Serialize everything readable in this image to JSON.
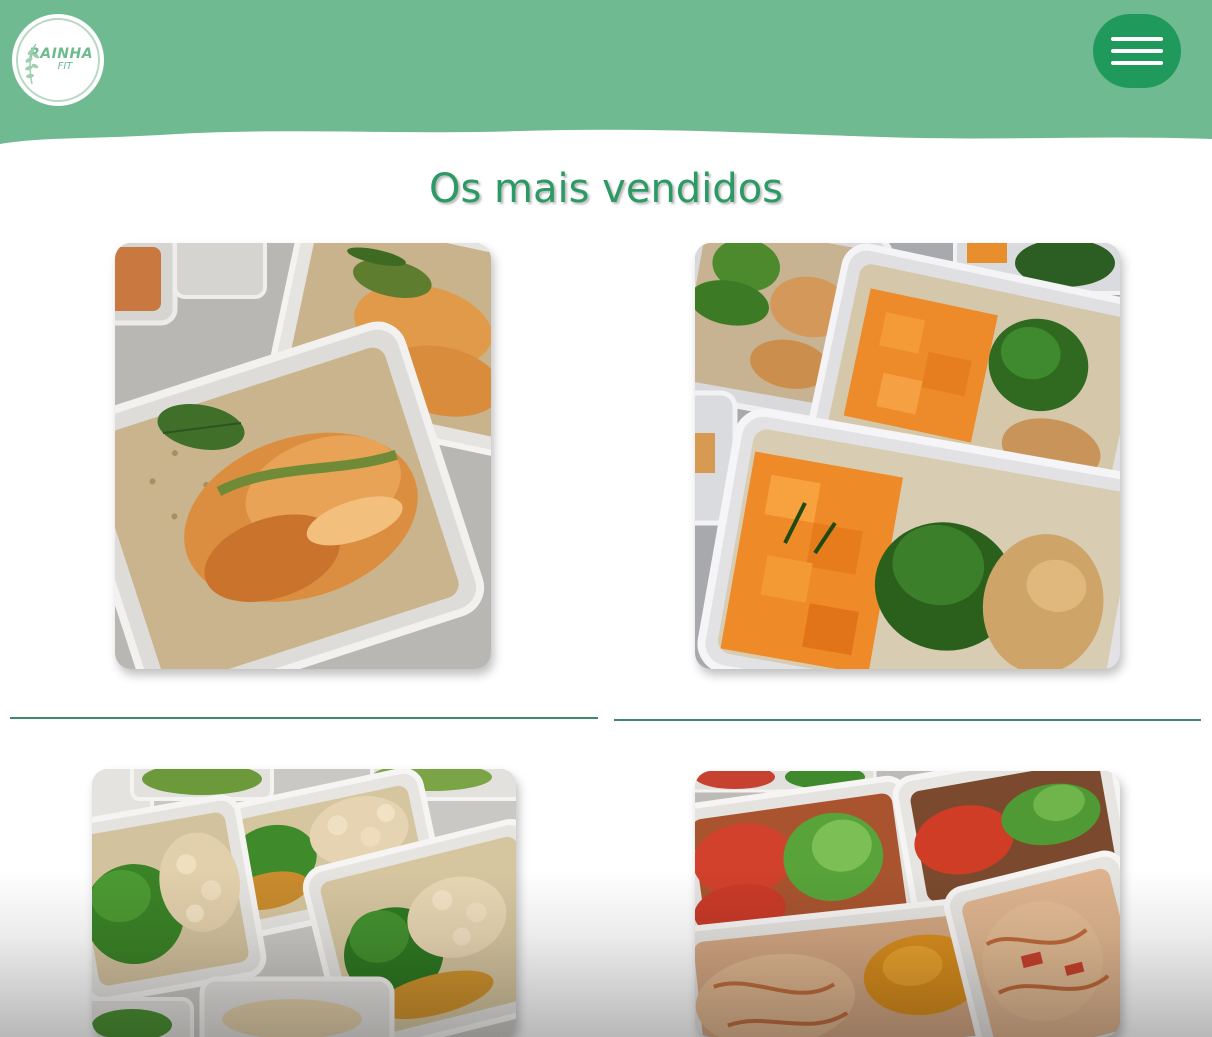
{
  "header": {
    "logo": {
      "title": "RAINHA",
      "subtitle": "FIT"
    },
    "menu_icon": "hamburger-icon",
    "colors": {
      "header_bg": "#6fba91",
      "menu_button_bg": "#1f9a5c"
    }
  },
  "main": {
    "section_title": "Os mais vendidos",
    "title_color": "#2c9a64",
    "products": [
      {
        "image": "rice-and-chicken-zucchini-meal-boxes"
      },
      {
        "image": "pumpkin-broccoli-rice-chicken-meal-boxes"
      },
      {
        "image": "broccoli-chicken-vegetable-meal-boxes"
      },
      {
        "image": "tomato-broccoli-shredded-chicken-meal-boxes"
      }
    ],
    "divider_color": "#3d8c69"
  }
}
